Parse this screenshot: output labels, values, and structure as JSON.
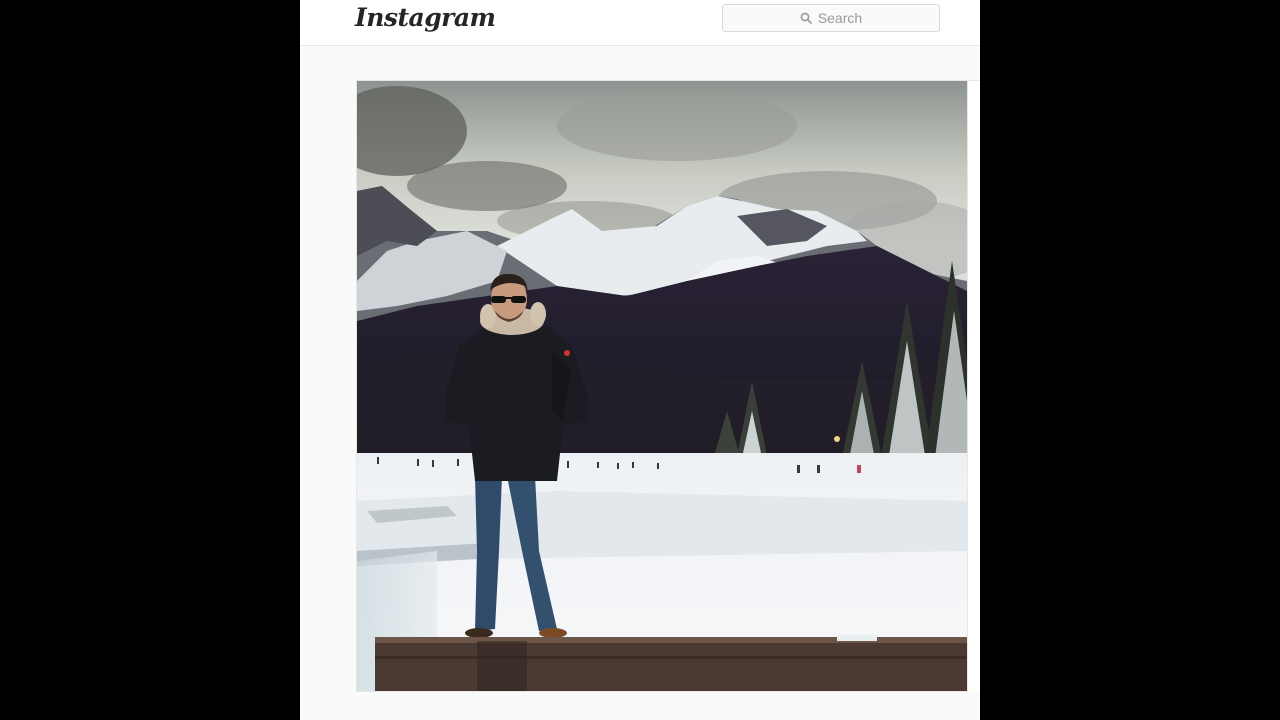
{
  "header": {
    "logo_text": "Instagram",
    "search": {
      "placeholder": "Search",
      "icon": "search-icon"
    }
  },
  "post": {
    "photo_subject": "person-standing-in-snow-with-mountains"
  },
  "colors": {
    "background": "#000000",
    "page": "#fafafa",
    "header": "#ffffff",
    "border": "#dbdbdb",
    "placeholder": "#999999"
  }
}
